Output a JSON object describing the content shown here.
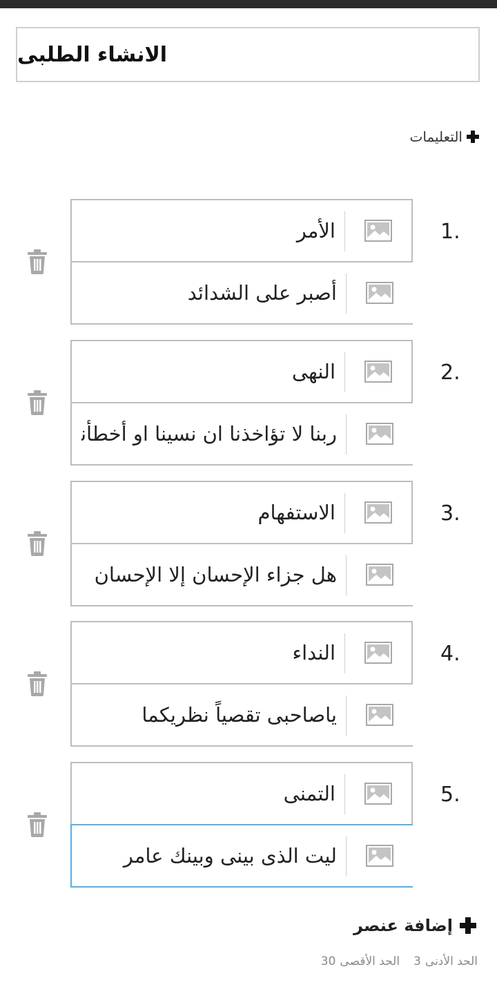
{
  "title": "الانشاء الطلبى",
  "instructions_label": "التعليمات",
  "items": [
    {
      "number": "1.",
      "term": "الأمر",
      "definition": "أصبر على الشدائد"
    },
    {
      "number": "2.",
      "term": "النهى",
      "definition": "ربنا لا تؤاخذنا ان نسينا او أخطأنا"
    },
    {
      "number": "3.",
      "term": "الاستفهام",
      "definition": "هل جزاء الإحسان إلا الإحسان"
    },
    {
      "number": "4.",
      "term": "النداء",
      "definition": "ياصاحبى تقصياً نظريكما"
    },
    {
      "number": "5.",
      "term": "التمنى",
      "definition": "ليت الذى بينى وبينك عامر"
    }
  ],
  "add_item_label": "إضافة عنصر",
  "limits": {
    "min_label": "الحد الأدنى",
    "min_value": "3",
    "max_label": "الحد الأقصى",
    "max_value": "30"
  },
  "colors": {
    "active_border": "#5aaee6",
    "border": "#bdbdbd",
    "icon_gray": "#a8a8a8"
  }
}
